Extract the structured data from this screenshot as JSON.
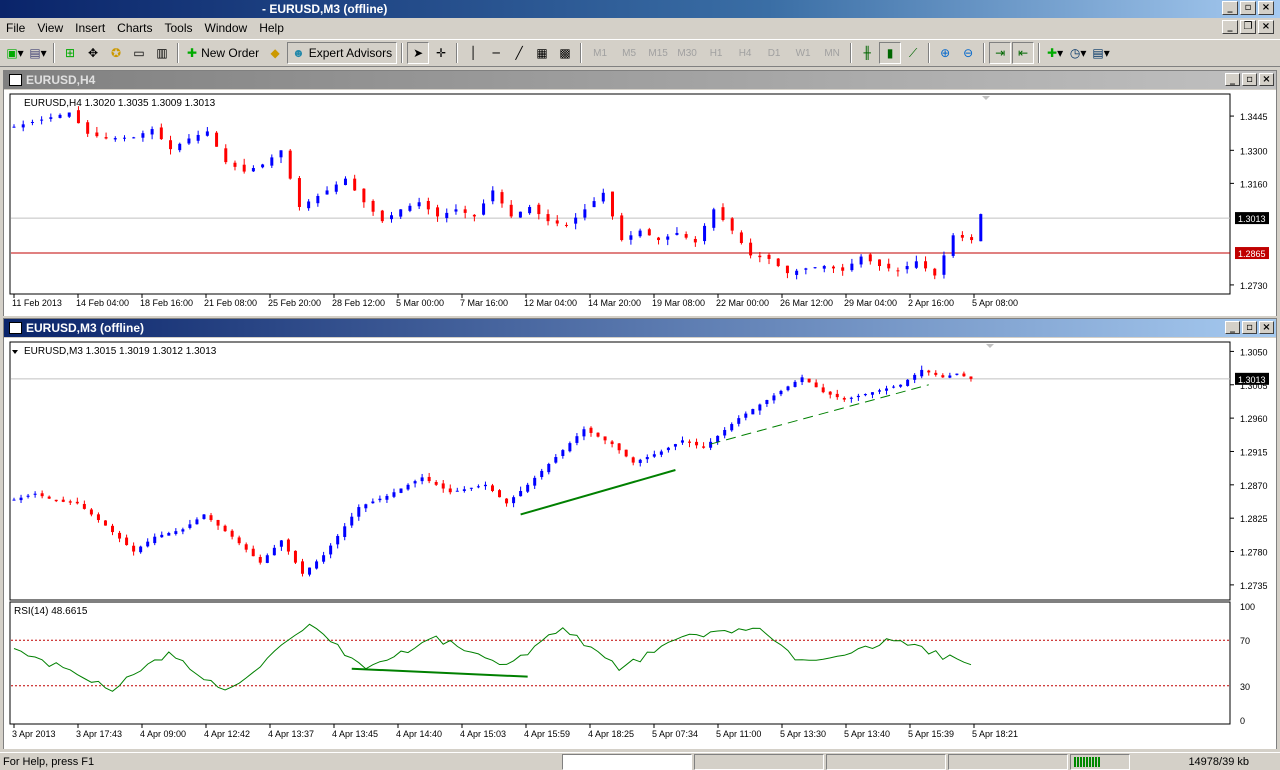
{
  "app_title": "- EURUSD,M3 (offline)",
  "menu": [
    "File",
    "View",
    "Insert",
    "Charts",
    "Tools",
    "Window",
    "Help"
  ],
  "toolbar": {
    "new_order": "New Order",
    "expert_advisors": "Expert Advisors",
    "timeframes": [
      "M1",
      "M5",
      "M15",
      "M30",
      "H1",
      "H4",
      "D1",
      "W1",
      "MN"
    ]
  },
  "window1": {
    "title": "EURUSD,H4",
    "info": "EURUSD,H4  1.3020 1.3035 1.3009 1.3013",
    "price_labels": [
      "1.3445",
      "1.3300",
      "1.3160",
      "1.3013",
      "1.2865",
      "1.2730"
    ],
    "current_price": "1.3013",
    "line_price": "1.2865",
    "time_labels": [
      "11 Feb 2013",
      "14 Feb 04:00",
      "18 Feb 16:00",
      "21 Feb 08:00",
      "25 Feb 20:00",
      "28 Feb 12:00",
      "5 Mar 00:00",
      "7 Mar 16:00",
      "12 Mar 04:00",
      "14 Mar 20:00",
      "19 Mar 08:00",
      "22 Mar 00:00",
      "26 Mar 12:00",
      "29 Mar 04:00",
      "2 Apr 16:00",
      "5 Apr 08:00"
    ]
  },
  "window2": {
    "title": "EURUSD,M3 (offline)",
    "info": "EURUSD,M3  1.3015 1.3019 1.3012 1.3013",
    "price_labels": [
      "1.3050",
      "1.3005",
      "1.2960",
      "1.2915",
      "1.2870",
      "1.2825",
      "1.2780",
      "1.2735"
    ],
    "current_price": "1.3013",
    "rsi_info": "RSI(14) 48.6615",
    "rsi_labels": [
      "100",
      "70",
      "30",
      "0"
    ],
    "time_labels": [
      "3 Apr 2013",
      "3 Apr 17:43",
      "4 Apr 09:00",
      "4 Apr 12:42",
      "4 Apr 13:37",
      "4 Apr 13:45",
      "4 Apr 14:40",
      "4 Apr 15:03",
      "4 Apr 15:59",
      "4 Apr 18:25",
      "5 Apr 07:34",
      "5 Apr 11:00",
      "5 Apr 13:30",
      "5 Apr 13:40",
      "5 Apr 15:39",
      "5 Apr 18:21"
    ]
  },
  "status": {
    "help": "For Help, press F1",
    "memory": "14978/39 kb"
  },
  "colors": {
    "bull": "#0000ff",
    "bear": "#ff0000",
    "rsi_line": "#008000",
    "trendline": "#008000",
    "level_line": "#c00000"
  },
  "chart_data": [
    {
      "type": "candlestick",
      "title": "EURUSD,H4",
      "ylim": [
        1.27,
        1.353
      ],
      "anchors": [
        [
          0,
          1.34
        ],
        [
          3,
          1.343
        ],
        [
          6,
          1.346
        ],
        [
          8,
          1.337
        ],
        [
          10,
          1.335
        ],
        [
          13,
          1.3355
        ],
        [
          15,
          1.339
        ],
        [
          17,
          1.3305
        ],
        [
          19,
          1.335
        ],
        [
          21,
          1.338
        ],
        [
          23,
          1.325
        ],
        [
          25,
          1.321
        ],
        [
          27,
          1.324
        ],
        [
          29,
          1.33
        ],
        [
          31,
          1.306
        ],
        [
          34,
          1.313
        ],
        [
          36,
          1.318
        ],
        [
          38,
          1.308
        ],
        [
          40,
          1.3
        ],
        [
          42,
          1.305
        ],
        [
          44,
          1.308
        ],
        [
          46,
          1.302
        ],
        [
          48,
          1.305
        ],
        [
          50,
          1.302
        ],
        [
          52,
          1.313
        ],
        [
          54,
          1.302
        ],
        [
          56,
          1.306
        ],
        [
          58,
          1.3
        ],
        [
          60,
          1.298
        ],
        [
          62,
          1.305
        ],
        [
          64,
          1.312
        ],
        [
          66,
          1.292
        ],
        [
          68,
          1.296
        ],
        [
          70,
          1.292
        ],
        [
          72,
          1.295
        ],
        [
          74,
          1.291
        ],
        [
          76,
          1.305
        ],
        [
          78,
          1.296
        ],
        [
          80,
          1.2855
        ],
        [
          82,
          1.284
        ],
        [
          84,
          1.278
        ],
        [
          86,
          1.28
        ],
        [
          88,
          1.281
        ],
        [
          90,
          1.279
        ],
        [
          92,
          1.285
        ],
        [
          94,
          1.281
        ],
        [
          96,
          1.279
        ],
        [
          98,
          1.283
        ],
        [
          100,
          1.277
        ],
        [
          102,
          1.294
        ],
        [
          104,
          1.292
        ],
        [
          105,
          1.303
        ]
      ]
    },
    {
      "type": "candlestick",
      "title": "EURUSD,M3",
      "ylim": [
        1.272,
        1.306
      ],
      "anchors": [
        [
          0,
          1.285
        ],
        [
          3,
          1.2858
        ],
        [
          6,
          1.2848
        ],
        [
          9,
          1.2845
        ],
        [
          13,
          1.2815
        ],
        [
          17,
          1.278
        ],
        [
          20,
          1.28
        ],
        [
          24,
          1.281
        ],
        [
          27,
          1.283
        ],
        [
          31,
          1.28
        ],
        [
          35,
          1.2765
        ],
        [
          38,
          1.2795
        ],
        [
          41,
          1.275
        ],
        [
          44,
          1.2775
        ],
        [
          49,
          1.284
        ],
        [
          53,
          1.2855
        ],
        [
          58,
          1.288
        ],
        [
          62,
          1.286
        ],
        [
          67,
          1.287
        ],
        [
          70,
          1.2845
        ],
        [
          73,
          1.287
        ],
        [
          81,
          1.2945
        ],
        [
          85,
          1.2925
        ],
        [
          88,
          1.29
        ],
        [
          92,
          1.2915
        ],
        [
          95,
          1.293
        ],
        [
          98,
          1.292
        ],
        [
          103,
          1.296
        ],
        [
          112,
          1.3015
        ],
        [
          115,
          1.2995
        ],
        [
          118,
          1.2985
        ],
        [
          122,
          1.2995
        ],
        [
          126,
          1.3005
        ],
        [
          129,
          1.3025
        ],
        [
          132,
          1.3015
        ],
        [
          134,
          1.302
        ],
        [
          136,
          1.3013
        ]
      ],
      "trendline_price": [
        [
          1.283,
          1.289
        ],
        [
          1.2925,
          1.3005
        ]
      ]
    },
    {
      "type": "line",
      "title": "RSI(14) 48.6615",
      "ylim": [
        0,
        100
      ],
      "levels": [
        70,
        30
      ],
      "anchors": [
        [
          0,
          62
        ],
        [
          14,
          28
        ],
        [
          22,
          58
        ],
        [
          30,
          25
        ],
        [
          42,
          82
        ],
        [
          50,
          45
        ],
        [
          60,
          72
        ],
        [
          70,
          47
        ],
        [
          78,
          82
        ],
        [
          86,
          45
        ],
        [
          95,
          72
        ],
        [
          105,
          82
        ],
        [
          112,
          50
        ],
        [
          125,
          70
        ],
        [
          136,
          48
        ]
      ],
      "divergence_line": [
        [
          48,
          45
        ],
        [
          73,
          38
        ]
      ]
    }
  ]
}
